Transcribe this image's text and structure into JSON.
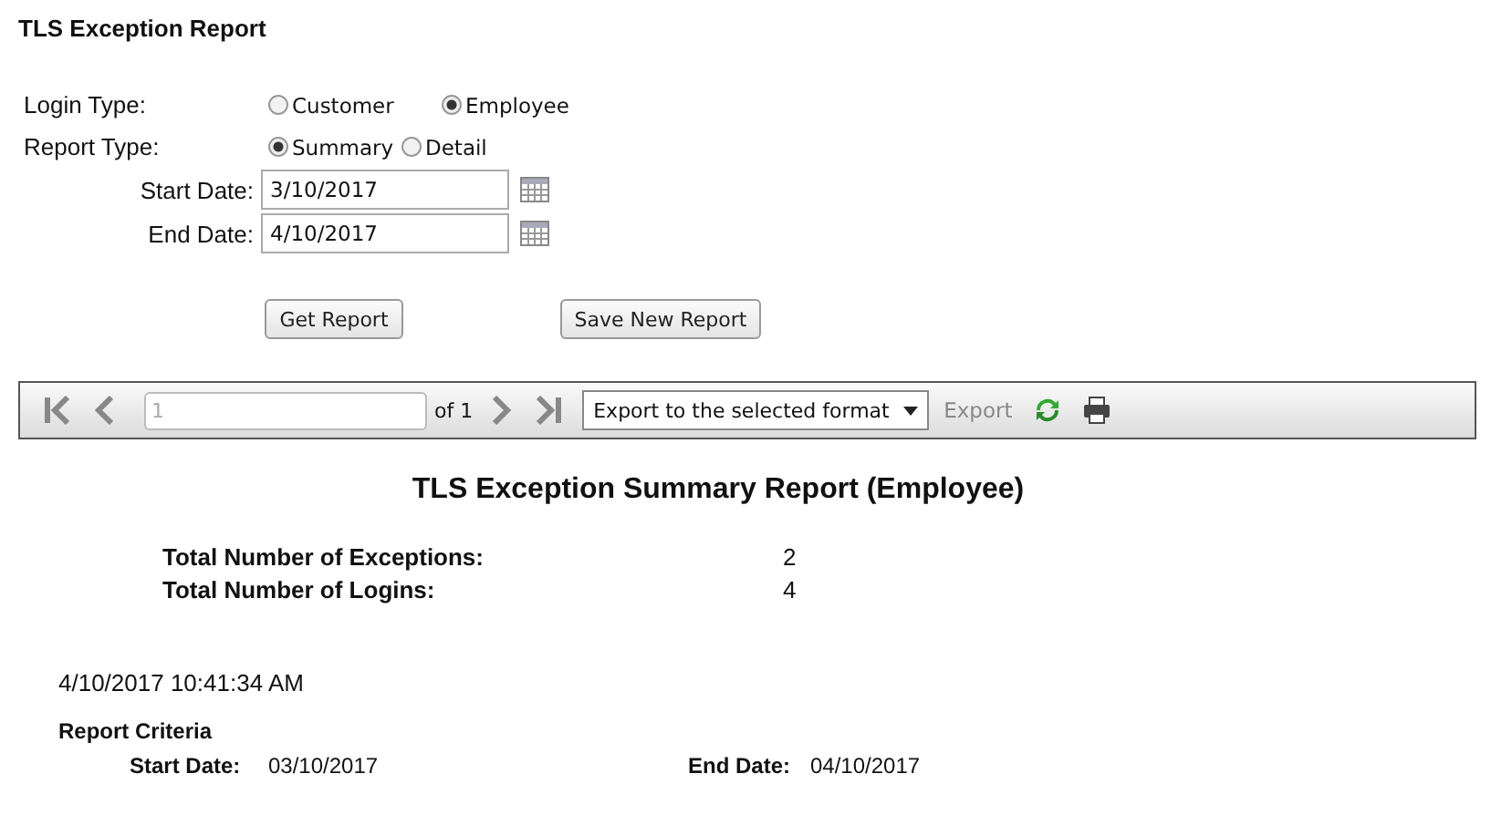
{
  "title": "TLS Exception Report",
  "radio_groups": [
    {
      "label": "Login Type:",
      "options": [
        {
          "label": "Customer",
          "selected": false
        },
        {
          "label": "Employee",
          "selected": true
        }
      ]
    },
    {
      "label": "Report Type:",
      "options": [
        {
          "label": "Summary",
          "selected": true
        },
        {
          "label": "Detail",
          "selected": false
        }
      ]
    }
  ],
  "dates": [
    {
      "label": "Start Date:",
      "value": "3/10/2017"
    },
    {
      "label": "End Date:",
      "value": "4/10/2017"
    }
  ],
  "buttons": [
    "Get Report",
    "Save New Report"
  ],
  "toolbar": {
    "page_value": "1",
    "page_count": "of 1",
    "export_format": "Export to the selected format",
    "export_button": {
      "label": "Export",
      "disabled": true
    }
  },
  "report": {
    "title": "TLS Exception Summary Report (Employee)",
    "totals": [
      {
        "label": "Total Number of Exceptions:",
        "value": "2"
      },
      {
        "label": "Total Number of Logins:",
        "value": "4"
      }
    ],
    "timestamp": "4/10/2017 10:41:34 AM",
    "criteria": {
      "heading": "Report Criteria",
      "items": [
        {
          "label": "Start Date:",
          "value": "03/10/2017"
        },
        {
          "label": "End Date:",
          "value": "04/10/2017"
        }
      ]
    }
  }
}
